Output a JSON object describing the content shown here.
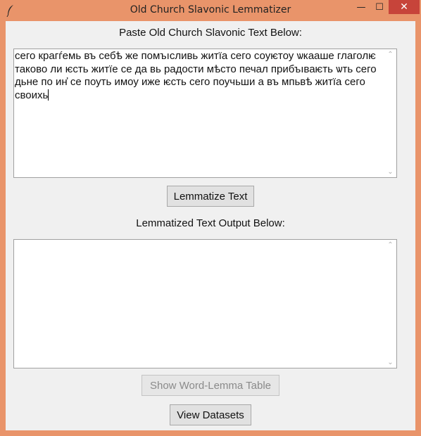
{
  "window": {
    "title": "Old Church Slavonic Lemmatizer",
    "icon": "feather-icon",
    "controls": {
      "minimize": "—",
      "maximize": "☐",
      "close": "✕"
    }
  },
  "input": {
    "label": "Paste Old Church Slavonic Text Below:",
    "value": "сего крагѓемь въ себѣ же помъıсливь житїа сего соуѥтоу ѡкааше глаголѥ таково ли ѥсть житїе се да вь радости мѣсто печал прибъıваѥть ѡть сего дьне по ин҆ се поуть имоу иже ѥсть сего поучьши а въ мпьвѣ житїа сего своихь"
  },
  "actions": {
    "lemmatize": "Lemmatize Text",
    "show_table": "Show Word-Lemma Table",
    "view_datasets": "View Datasets"
  },
  "output": {
    "label": "Lemmatized Text Output Below:",
    "value": ""
  },
  "colors": {
    "frame": "#e9946a",
    "client": "#f0f0f0",
    "close": "#c7443a"
  }
}
